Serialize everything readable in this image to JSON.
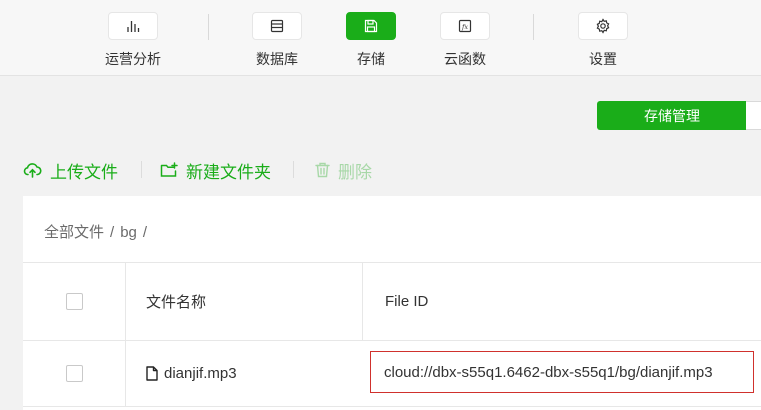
{
  "toolbar": {
    "items": [
      {
        "label": "运营分析",
        "icon": "bar-chart-icon"
      },
      {
        "label": "数据库",
        "icon": "database-icon"
      },
      {
        "label": "存储",
        "icon": "save-icon"
      },
      {
        "label": "云函数",
        "icon": "function-icon"
      },
      {
        "label": "设置",
        "icon": "gear-icon"
      }
    ],
    "active": "存储",
    "accent": "#1aad19"
  },
  "tab": {
    "label": "存储管理"
  },
  "actions": {
    "upload": "上传文件",
    "new_folder": "新建文件夹",
    "delete": "删除"
  },
  "breadcrumb": {
    "root": "全部文件",
    "sep": "/",
    "folder": "bg",
    "trail": "/"
  },
  "table": {
    "columns": [
      "文件名称",
      "File ID"
    ],
    "rows": [
      {
        "name": "dianjif.mp3",
        "file_id": "cloud://dbx-s55q1.6462-dbx-s55q1/bg/dianjif.mp3"
      }
    ]
  }
}
